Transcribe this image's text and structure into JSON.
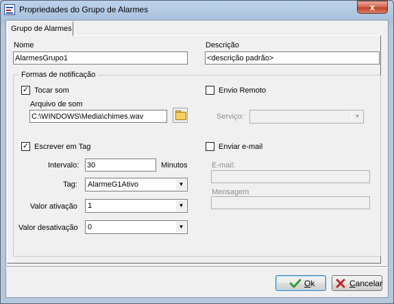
{
  "window": {
    "title": "Propriedades do Grupo de Alarmes",
    "close_glyph": "x"
  },
  "tabs": [
    {
      "label": "Grupo de Alarmes",
      "active": true
    }
  ],
  "nome": {
    "label": "Nome",
    "value": "AlarmesGrupo1"
  },
  "descricao": {
    "label": "Descrição",
    "value": "<descrição padrão>"
  },
  "notificacao": {
    "group_title": "Formas de notificação",
    "tocar_som": {
      "label": "Tocar som",
      "checked": true,
      "check_glyph": "✓",
      "arquivo_label": "Arquivo de som",
      "arquivo_value": "C:\\WINDOWS\\Media\\chimes.wav"
    },
    "escrever_tag": {
      "label": "Escrever em Tag",
      "checked": true,
      "check_glyph": "✓",
      "intervalo_label": "Intervalo:",
      "intervalo_value": "30",
      "intervalo_unit": "Minutos",
      "tag_label": "Tag:",
      "tag_value": "AlarmeG1Ativo",
      "valor_ativacao_label": "Valor ativação",
      "valor_ativacao_value": "1",
      "valor_desativacao_label": "Valor desativação",
      "valor_desativacao_value": "0"
    },
    "envio_remoto": {
      "label": "Envio Remoto",
      "checked": false,
      "servico_label": "Serviço:",
      "servico_value": ""
    },
    "enviar_email": {
      "label": "Enviar e-mail",
      "checked": false,
      "email_label": "E-mail:",
      "email_value": "",
      "mensagem_label": "Mensagem",
      "mensagem_value": ""
    }
  },
  "buttons": {
    "ok": {
      "label_underlined": "O",
      "label_rest": "k"
    },
    "cancel": {
      "label_underlined": "C",
      "label_rest": "ancelar"
    }
  },
  "colors": {
    "ok_icon": "#2e9a2e",
    "cancel_icon": "#c42222"
  }
}
